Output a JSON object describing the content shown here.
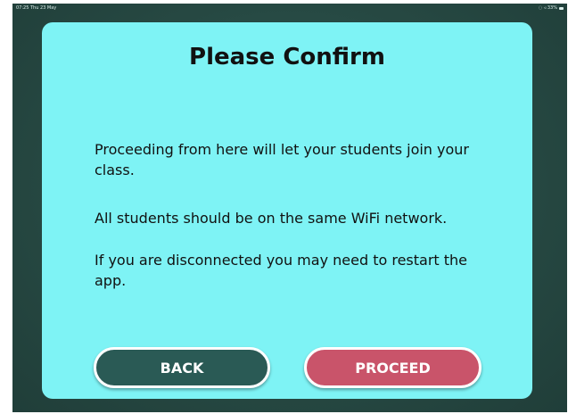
{
  "status_bar": {
    "time_date": "07:25  Thu 23 May",
    "indicators": "◌ ◃ 33%"
  },
  "dialog": {
    "title": "Please Confirm",
    "paragraph_1": "Proceeding from here will let your students join your class.",
    "paragraph_2": "All students should be on the same WiFi network.",
    "paragraph_3": "If you are disconnected you may need to restart the app."
  },
  "buttons": {
    "back_label": "BACK",
    "proceed_label": "PROCEED"
  },
  "colors": {
    "background": "#28504a",
    "dialog": "#7ef3f5",
    "back_button": "#2a5a55",
    "proceed_button": "#c9546a"
  }
}
